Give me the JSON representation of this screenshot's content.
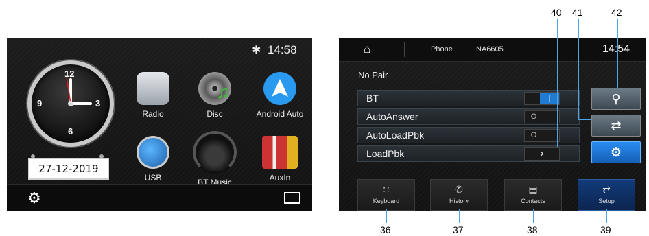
{
  "home": {
    "status_time": "14:58",
    "bt_icon": "bluetooth-icon",
    "clock_numbers": {
      "n12": "12",
      "n3": "3",
      "n6": "6",
      "n9": "9"
    },
    "date": "27-12-2019",
    "apps": [
      {
        "label": "Radio",
        "icon": "radio-icon"
      },
      {
        "label": "Disc",
        "icon": "disc-icon"
      },
      {
        "label": "Android Auto",
        "icon": "android-auto-icon"
      },
      {
        "label": "USB",
        "icon": "usb-icon"
      },
      {
        "label": "BT Music",
        "icon": "headphones-icon"
      },
      {
        "label": "AuxIn",
        "icon": "rca-cable-icon"
      }
    ],
    "bottom_left_icon": "gear-icon",
    "bottom_right_icon": "monitor-icon"
  },
  "phone": {
    "home_icon": "home-icon",
    "title": "Phone",
    "device": "NA6605",
    "time": "14:54",
    "pair_status": "No Pair",
    "rows": [
      {
        "label": "BT"
      },
      {
        "label": "AutoAnswer"
      },
      {
        "label": "AutoLoadPbk"
      },
      {
        "label": "LoadPbk"
      }
    ],
    "side_buttons": [
      "search-icon",
      "swap-icon",
      "settings-icon"
    ],
    "tabs": [
      {
        "label": "Keyboard",
        "icon": "keypad-icon"
      },
      {
        "label": "History",
        "icon": "call-history-icon"
      },
      {
        "label": "Contacts",
        "icon": "contacts-icon"
      },
      {
        "label": "Setup",
        "icon": "swap-icon"
      }
    ]
  },
  "callouts": {
    "c40": "40",
    "c41": "41",
    "c42": "42",
    "c36": "36",
    "c37": "37",
    "c38": "38",
    "c39": "39"
  },
  "colors": {
    "accent_blue": "#1f7bd4",
    "callout_line": "#4aa6e8",
    "screen_bg": "#161616"
  }
}
